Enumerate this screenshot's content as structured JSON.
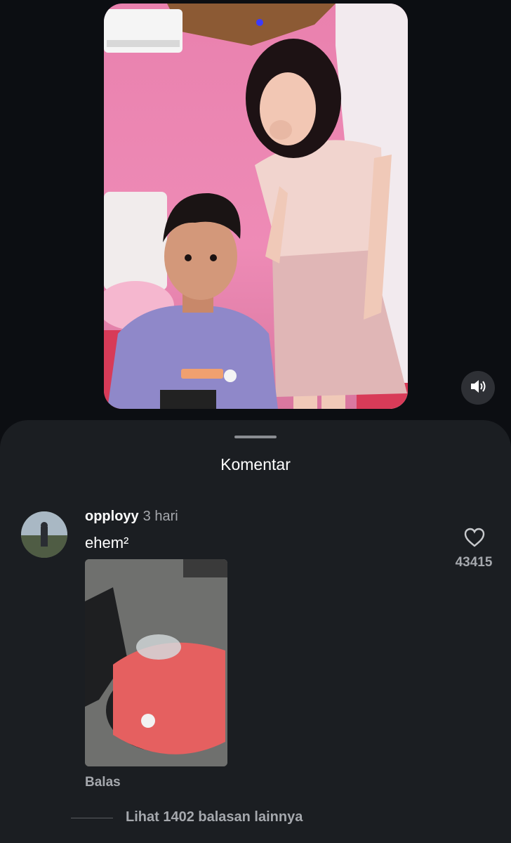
{
  "video": {
    "mute_icon": "speaker-muted-icon"
  },
  "comments_sheet": {
    "title": "Komentar"
  },
  "comment": {
    "username": "opployy",
    "time": "3 hari",
    "text": "ehem²",
    "like_count": "43415",
    "like_icon": "heart-outline-icon",
    "reply_label": "Balas",
    "more_replies_label": "Lihat 1402 balasan lainnya"
  },
  "colors": {
    "background": "#0c0e12",
    "sheet": "#1b1e22",
    "secondary_text": "#a5a8ad",
    "primary_text": "#ffffff"
  }
}
